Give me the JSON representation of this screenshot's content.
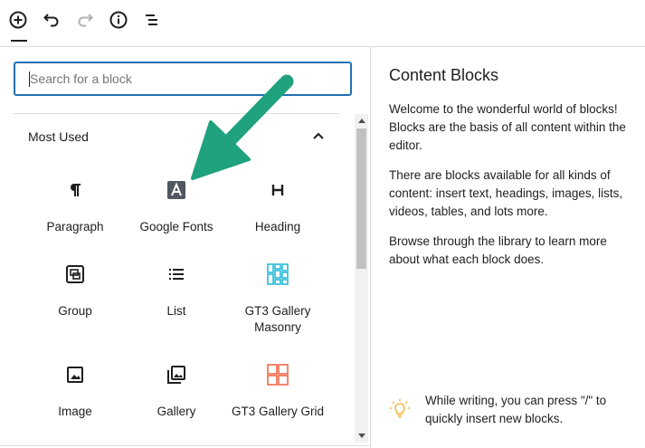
{
  "toolbar": {
    "items": [
      "add-block",
      "undo",
      "redo",
      "info",
      "outline"
    ]
  },
  "search": {
    "placeholder": "Search for a block",
    "value": ""
  },
  "section": {
    "title": "Most Used"
  },
  "blocks": [
    {
      "label": "Paragraph",
      "icon": "paragraph-icon"
    },
    {
      "label": "Google Fonts",
      "icon": "google-fonts-icon"
    },
    {
      "label": "Heading",
      "icon": "heading-icon"
    },
    {
      "label": "Group",
      "icon": "group-icon"
    },
    {
      "label": "List",
      "icon": "list-icon"
    },
    {
      "label": "GT3 Gallery Masonry",
      "icon": "gt3-masonry-icon"
    },
    {
      "label": "Image",
      "icon": "image-icon"
    },
    {
      "label": "Gallery",
      "icon": "gallery-icon"
    },
    {
      "label": "GT3 Gallery Grid",
      "icon": "gt3-grid-icon"
    }
  ],
  "inspector": {
    "title": "Content Blocks",
    "p1": "Welcome to the wonderful world of blocks! Blocks are the basis of all content within the editor.",
    "p2": "There are blocks available for all kinds of content: insert text, headings, images, lists, videos, tables, and lots more.",
    "p3": "Browse through the library to learn more about what each block does.",
    "tip": "While writing, you can press \"/\" to quickly insert new blocks."
  },
  "colors": {
    "accent": "#2271b1",
    "arrow": "#1fa27d",
    "gt3_masonry": "#2bbbd8",
    "gt3_grid": "#f0694a",
    "tip": "#f0b849"
  }
}
